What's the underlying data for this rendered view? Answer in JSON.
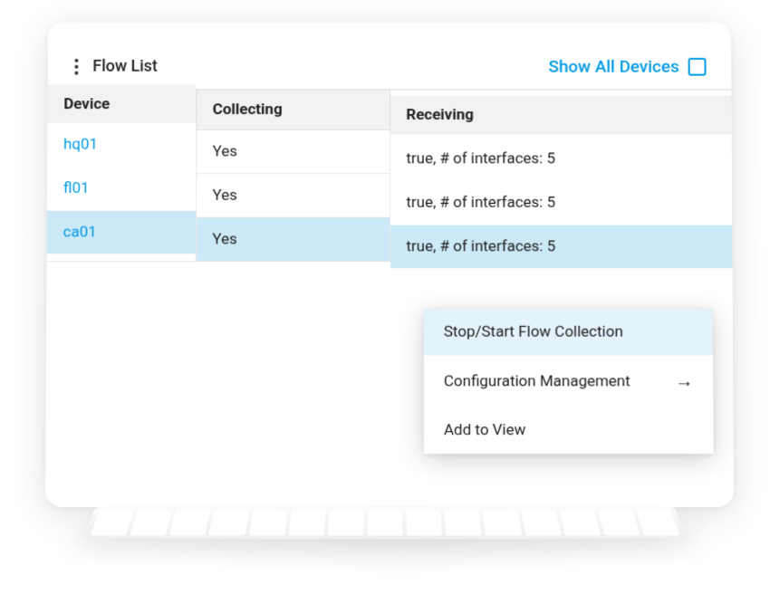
{
  "panel": {
    "title": "Flow List",
    "show_all_label": "Show All Devices"
  },
  "table": {
    "headers": {
      "device": "Device",
      "collecting": "Collecting",
      "receiving": "Receiving"
    },
    "rows": [
      {
        "device": "hq01",
        "collecting": "Yes",
        "receiving": "true, # of interfaces: 5"
      },
      {
        "device": "fl01",
        "collecting": "Yes",
        "receiving": "true, # of interfaces: 5"
      },
      {
        "device": "ca01",
        "collecting": "Yes",
        "receiving": "true, # of interfaces: 5"
      }
    ]
  },
  "context_menu": {
    "items": [
      {
        "label": "Stop/Start Flow Collection",
        "has_submenu": false
      },
      {
        "label": "Configuration Management",
        "has_submenu": true
      },
      {
        "label": "Add to View",
        "has_submenu": false
      }
    ]
  }
}
